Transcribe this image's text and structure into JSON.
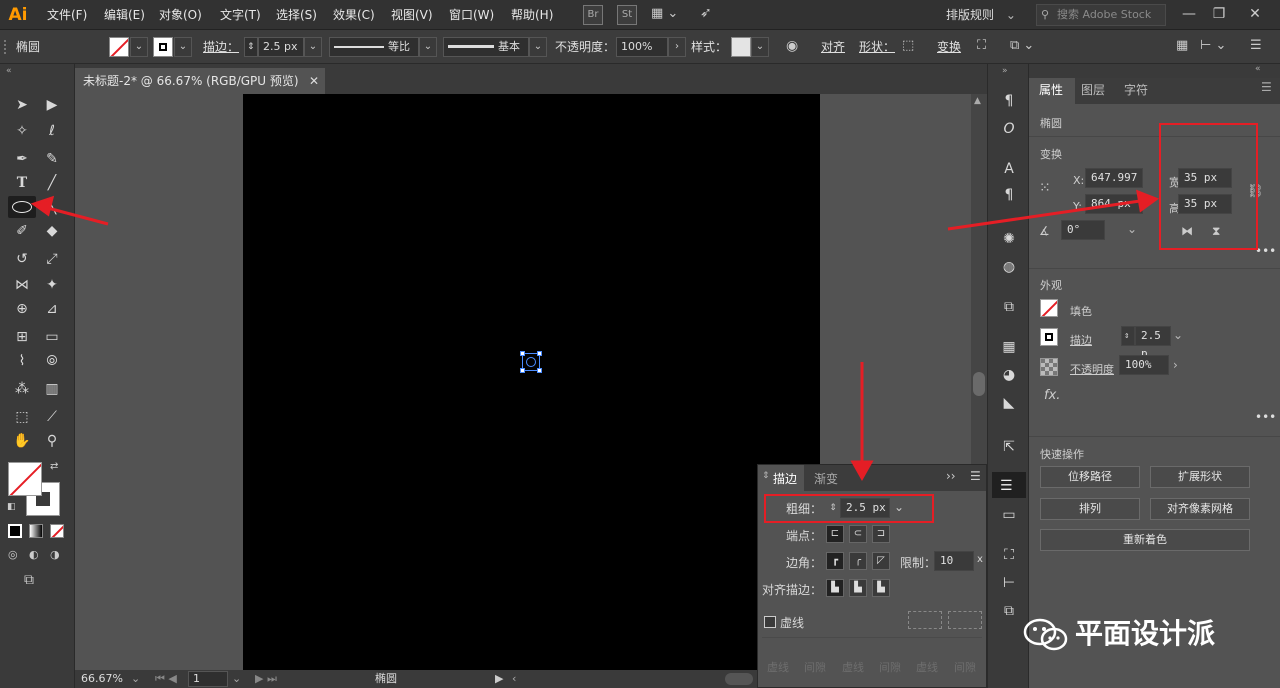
{
  "app": {
    "logo": "Ai"
  },
  "menubar": {
    "items": [
      "文件(F)",
      "编辑(E)",
      "对象(O)",
      "文字(T)",
      "选择(S)",
      "效果(C)",
      "视图(V)",
      "窗口(W)",
      "帮助(H)"
    ],
    "bridge_icon": "Br",
    "stock_icon": "St",
    "layout_preset": "排版规则",
    "search_placeholder": "搜索 Adobe Stock"
  },
  "controlbar": {
    "object_label": "椭圆",
    "stroke_label": "描边：",
    "stroke_value": "2.5 px",
    "profile_label": "等比",
    "brush_label": "基本",
    "opacity_label": "不透明度：",
    "opacity_value": "100%",
    "style_label": "样式：",
    "align_label": "对齐",
    "shape_label": "形状：",
    "transform_label": "变换"
  },
  "document": {
    "tab_title": "未标题-2* @ 66.67% (RGB/GPU 预览)",
    "zoom": "66.67%",
    "page": "1",
    "status": "椭圆"
  },
  "properties": {
    "tabs": [
      "属性",
      "图层",
      "字符"
    ],
    "object_type": "椭圆",
    "transform_title": "变换",
    "x_label": "X:",
    "x_value": "647.997",
    "y_label": "Y:",
    "y_value": "864 px",
    "w_label": "宽:",
    "w_value": "35 px",
    "h_label": "高:",
    "h_value": "35 px",
    "angle_value": "0°",
    "appearance_title": "外观",
    "fill_label": "填色",
    "stroke_label": "描边",
    "stroke_value": "2.5 p",
    "opacity_label": "不透明度",
    "opacity_value": "100%",
    "fx_label": "fx.",
    "quick_title": "快速操作",
    "btn_offset_path": "位移路径",
    "btn_expand": "扩展形状",
    "btn_arrange": "排列",
    "btn_pixel_grid": "对齐像素网格",
    "btn_recolor": "重新着色"
  },
  "stroke_panel": {
    "tab_stroke": "描边",
    "tab_gradient": "渐变",
    "weight_label": "粗细：",
    "weight_value": "2.5 px",
    "cap_label": "端点：",
    "corner_label": "边角：",
    "limit_label": "限制：",
    "limit_value": "10",
    "limit_unit": "x",
    "align_label": "对齐描边：",
    "dashed_label": "虚线",
    "dash_labels": [
      "虚线",
      "间隙",
      "虚线",
      "间隙",
      "虚线",
      "间隙"
    ]
  },
  "watermark": {
    "text": "平面设计派"
  },
  "colors": {
    "accent_red": "#e51e25",
    "ai_orange": "#ff9a00",
    "selection_blue": "#4a8cff"
  }
}
